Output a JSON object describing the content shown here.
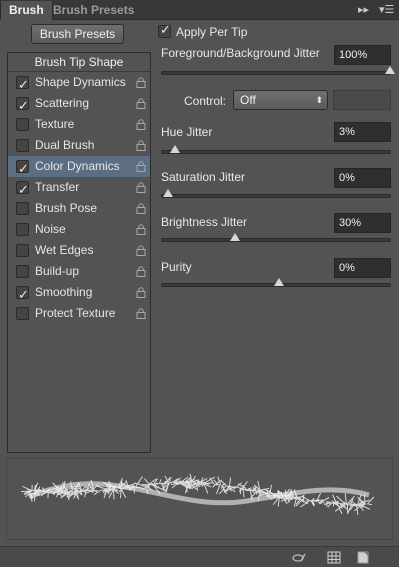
{
  "tabs": [
    {
      "label": "Brush",
      "active": true
    },
    {
      "label": "Brush Presets",
      "active": false
    }
  ],
  "header_controls": {
    "collapse_icon": "double-arrow-icon",
    "menu_icon": "panel-menu-icon"
  },
  "brush_presets_button": "Brush Presets",
  "options_list": {
    "header": "Brush Tip Shape",
    "items": [
      {
        "label": "Shape Dynamics",
        "checked": true,
        "selected": false
      },
      {
        "label": "Scattering",
        "checked": true,
        "selected": false
      },
      {
        "label": "Texture",
        "checked": false,
        "selected": false
      },
      {
        "label": "Dual Brush",
        "checked": false,
        "selected": false
      },
      {
        "label": "Color Dynamics",
        "checked": true,
        "selected": true
      },
      {
        "label": "Transfer",
        "checked": true,
        "selected": false
      },
      {
        "label": "Brush Pose",
        "checked": false,
        "selected": false
      },
      {
        "label": "Noise",
        "checked": false,
        "selected": false
      },
      {
        "label": "Wet Edges",
        "checked": false,
        "selected": false
      },
      {
        "label": "Build-up",
        "checked": false,
        "selected": false
      },
      {
        "label": "Smoothing",
        "checked": true,
        "selected": false
      },
      {
        "label": "Protect Texture",
        "checked": false,
        "selected": false
      }
    ]
  },
  "apply_per_tip": {
    "label": "Apply Per Tip",
    "checked": true
  },
  "settings": {
    "fg_bg_jitter": {
      "label": "Foreground/Background Jitter",
      "value": "100%",
      "level": 100
    },
    "control": {
      "label": "Control:",
      "value": "Off"
    },
    "hue_jitter": {
      "label": "Hue Jitter",
      "value": "3%",
      "level": 3
    },
    "saturation_jitter": {
      "label": "Saturation Jitter",
      "value": "0%",
      "level": 0
    },
    "brightness_jitter": {
      "label": "Brightness Jitter",
      "value": "30%",
      "level": 30
    },
    "purity": {
      "label": "Purity",
      "value": "0%",
      "level": 50
    }
  },
  "colors": {
    "panel_bg": "#535353",
    "selected_row": "#5c6e82",
    "field_bg": "#2f2f2f"
  },
  "bottom_icons": [
    "toggle-live-tip-preview-icon",
    "create-brush-grid-icon",
    "new-brush-icon"
  ]
}
